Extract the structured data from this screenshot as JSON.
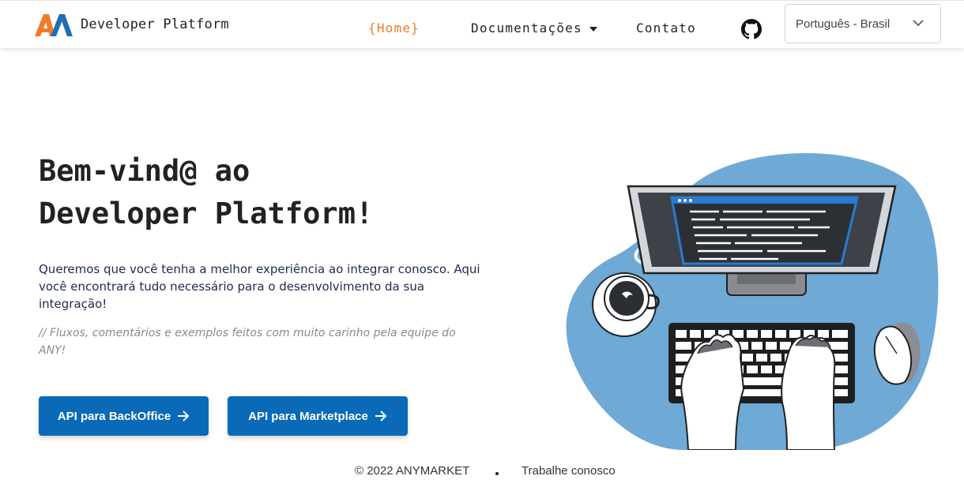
{
  "header": {
    "brand_name": "Developer Platform",
    "nav": {
      "home": "{Home}",
      "docs": "Documentações",
      "contact": "Contato"
    },
    "language": {
      "selected": "Português - Brasil"
    }
  },
  "hero": {
    "title_line1": "Bem-vind@ ao",
    "title_line2": "Developer Platform!",
    "intro": "Queremos que você tenha a melhor experiência ao integrar conosco. Aqui você encontrará tudo necessário para o desenvolvimento da sua integração!",
    "comment": "// Fluxos, comentários e exemplos feitos com muito carinho pela equipe do ANY!",
    "buttons": {
      "backoffice": "API para BackOffice",
      "marketplace": "API para Marketplace"
    }
  },
  "footer": {
    "copyright": "© 2022 ANYMARKET",
    "careers": "Trabalhe conosco"
  },
  "colors": {
    "accent": "#f07a2a",
    "primary": "#0a6ab8",
    "illustration_blue": "#6fa9d6"
  }
}
